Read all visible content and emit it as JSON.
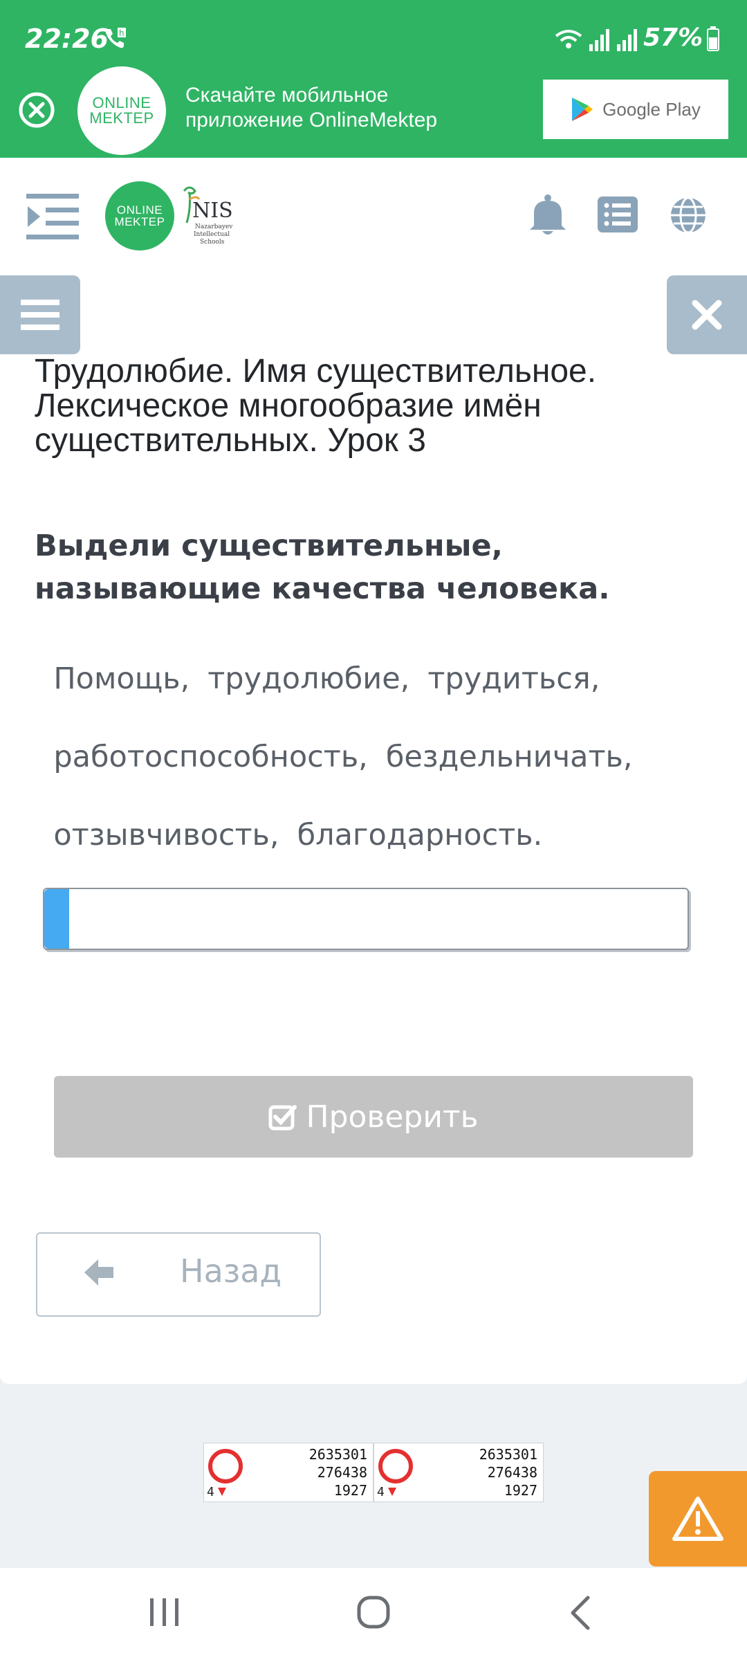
{
  "status_bar": {
    "time": "22:26",
    "battery": "57%"
  },
  "promo": {
    "logo_line1": "ONLINE",
    "logo_line2": "MEKTEP",
    "text": "Скачайте мобильное приложение OnlineMektep",
    "store_button": "Google Play"
  },
  "header": {
    "logo_line1": "ONLINE",
    "logo_line2": "MEKTEP",
    "nis_name": "NIS",
    "nis_sub1": "Nazarbayev",
    "nis_sub2": "Intellectual",
    "nis_sub3": "Schools"
  },
  "lesson": {
    "title": "Трудолюбие. Имя существительное. Лексическое многообразие имён существительных. Урок 3",
    "prompt": "Выдели существительные, называющие качества человека.",
    "word_lines": [
      [
        "Помощь,",
        "трудолюбие,",
        "трудиться,"
      ],
      [
        "работоспособность,",
        "бездельничать,"
      ],
      [
        "отзывчивость,",
        "благодарность."
      ]
    ],
    "check_button": "Проверить",
    "back_button": "Назад"
  },
  "counters": [
    {
      "four": "4",
      "line1": "2635301",
      "line2": "276438",
      "line3": "1927"
    },
    {
      "four": "4",
      "line1": "2635301",
      "line2": "276438",
      "line3": "1927"
    }
  ],
  "colors": {
    "brand_green": "#2fb464",
    "side_button": "#a9bccb",
    "input_accent": "#45aaf2",
    "disabled_button": "#c3c3c3",
    "report_orange": "#f2992e"
  }
}
